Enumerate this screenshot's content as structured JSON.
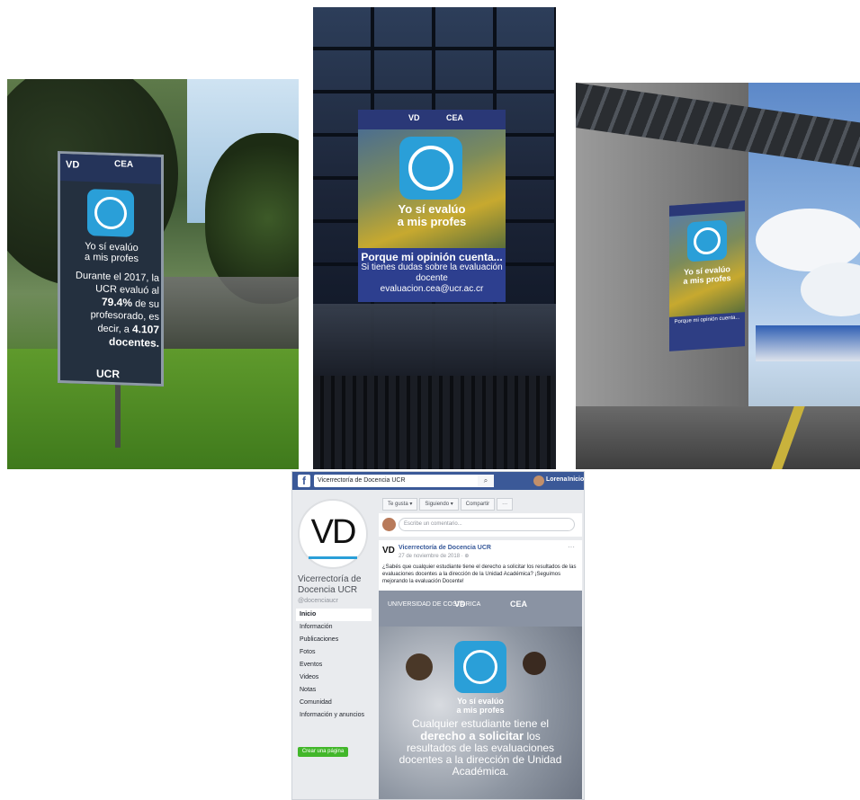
{
  "photo1": {
    "vd": "VD",
    "cea": "CEA",
    "slogan_line1": "Yo sí evalúo",
    "slogan_line2": "a mis profes",
    "body_line1": "Durante el 2017, la",
    "body_line2": "UCR evaluó al",
    "body_pct": "79.4%",
    "body_line3": "de su",
    "body_line4": "profesorado, es",
    "body_line5": "decir, a",
    "body_count": "4.107",
    "body_line6": "docentes.",
    "ucr": "UCR"
  },
  "photo2": {
    "vd": "VD",
    "cea": "CEA",
    "slogan_line1": "Yo sí evalúo",
    "slogan_line2": "a mis profes",
    "sub_line1": "Porque mi opinión cuenta...",
    "sub_line2": "Si tienes dudas sobre la evaluación docente",
    "sub_line3": "evaluacion.cea@ucr.ac.cr"
  },
  "photo3": {
    "slogan_line1": "Yo sí evalúo",
    "slogan_line2": "a mis profes",
    "sub_line1": "Porque mi opinión cuenta..."
  },
  "facebook": {
    "logo": "f",
    "search_value": "Vicerrectoría de Docencia UCR",
    "user_name": "Lorena",
    "home_label": "Inicio",
    "profile_initials": "VD",
    "page_name": "Vicerrectoría de Docencia UCR",
    "handle": "@docenciaucr",
    "nav": [
      "Inicio",
      "Información",
      "Publicaciones",
      "Fotos",
      "Eventos",
      "Videos",
      "Notas",
      "Comunidad",
      "Información y anuncios"
    ],
    "create_page": "Crear una página",
    "actions": [
      "Te gusta ▾",
      "Siguiendo ▾",
      "Compartir",
      "···"
    ],
    "comment_placeholder": "Escribe un comentario...",
    "post": {
      "avatar": "VD",
      "author": "Vicerrectoría de Docencia UCR",
      "date": "27 de noviembre de 2018 · ⊕",
      "more": "···",
      "text": "¿Sabés que cualquier estudiante tiene el derecho a solicitar los resultados de las evaluaciones docentes a la dirección de la Unidad Académica? ¡Seguimos mejorando la evaluación Docente!",
      "img_university": "UNIVERSIDAD DE COSTA RICA",
      "img_vd": "VD",
      "img_cea": "CEA",
      "img_slogan_line1": "Yo sí evalúo",
      "img_slogan_line2": "a mis profes",
      "img_caption_line1": "Cualquier estudiante tiene el",
      "img_caption_bold": "derecho a solicitar",
      "img_caption_line2": "los",
      "img_caption_line3": "resultados de las evaluaciones",
      "img_caption_line4": "docentes a la dirección de Unidad",
      "img_caption_line5": "Académica."
    }
  }
}
